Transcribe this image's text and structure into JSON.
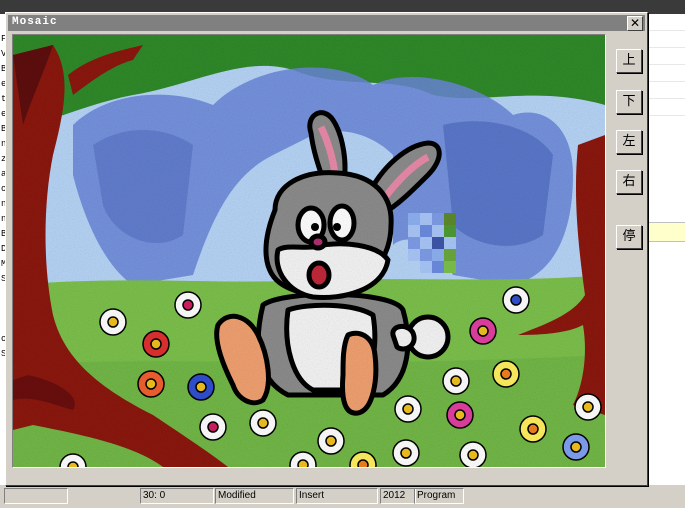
{
  "window": {
    "title": "Mosaic",
    "close_label": "✕"
  },
  "controls": {
    "up": "上",
    "down": "下",
    "left": "左",
    "right": "右",
    "stop": "停"
  },
  "background_left_labels": [
    "Fo",
    "VC",
    "Br",
    "e",
    "to",
    "eB",
    "By",
    "n:",
    "ze",
    "ate",
    "ok",
    "nt",
    "nt",
    "B:",
    "D:",
    "M:",
    "S:",
    "",
    "",
    "",
    "o",
    "S"
  ],
  "status_bar": {
    "cell_a": "",
    "cell_b": "30: 0",
    "cell_c": "Modified",
    "cell_d": "Insert",
    "cell_e": "2012",
    "cell_f": "Program"
  },
  "colors": {
    "titlebar": "#808080",
    "face": "#d4d0c8",
    "sky": "#b8d8f8",
    "grass": "#7cc04c",
    "tree": "#8b1a10",
    "rabbit_gray": "#8c8c8c"
  }
}
